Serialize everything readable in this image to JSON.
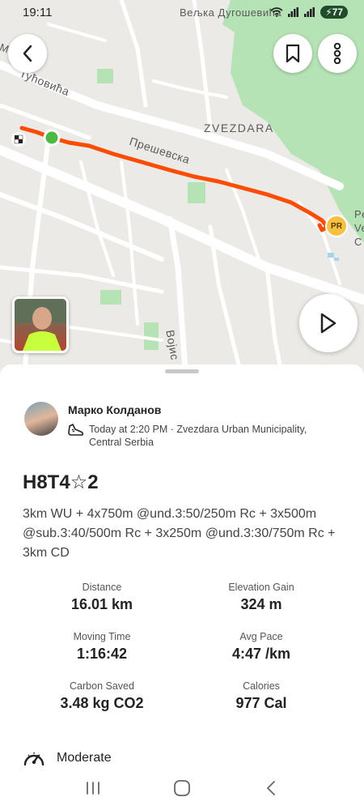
{
  "status_bar": {
    "time": "19:11",
    "battery": "77"
  },
  "map": {
    "labels": {
      "street_top_right": "Вељка Дугошевића",
      "street_top_left": "Тућовића",
      "street_top_left_prefix": "M",
      "district": "ZVEZDARA",
      "street_mid": "Прешевска",
      "street_bottom": "Војис",
      "edge_top_right": "Pe",
      "edge_mid_right": "Ve",
      "edge_bottom_right": "C"
    },
    "pr_badge": "PR",
    "colors": {
      "route": "#fc4c02",
      "park": "#b6e3b6",
      "start": "#4cb944"
    }
  },
  "activity": {
    "athlete_name": "Марко Колданов",
    "meta": "Today at 2:20 PM · Zvezdara Urban Municipality, Central Serbia",
    "title": "H8T4☆2",
    "description": "3km WU + 4x750m @und.3:50/250m Rc + 3x500m @sub.3:40/500m Rc + 3x250m @und.3:30/750m Rc + 3km CD",
    "stats": [
      {
        "label": "Distance",
        "value": "16.01 km"
      },
      {
        "label": "Elevation Gain",
        "value": "324 m"
      },
      {
        "label": "Moving Time",
        "value": "1:16:42"
      },
      {
        "label": "Avg Pace",
        "value": "4:47 /km"
      },
      {
        "label": "Carbon Saved",
        "value": "3.48 kg CO2"
      },
      {
        "label": "Calories",
        "value": "977 Cal"
      }
    ],
    "effort_label": "Moderate"
  }
}
